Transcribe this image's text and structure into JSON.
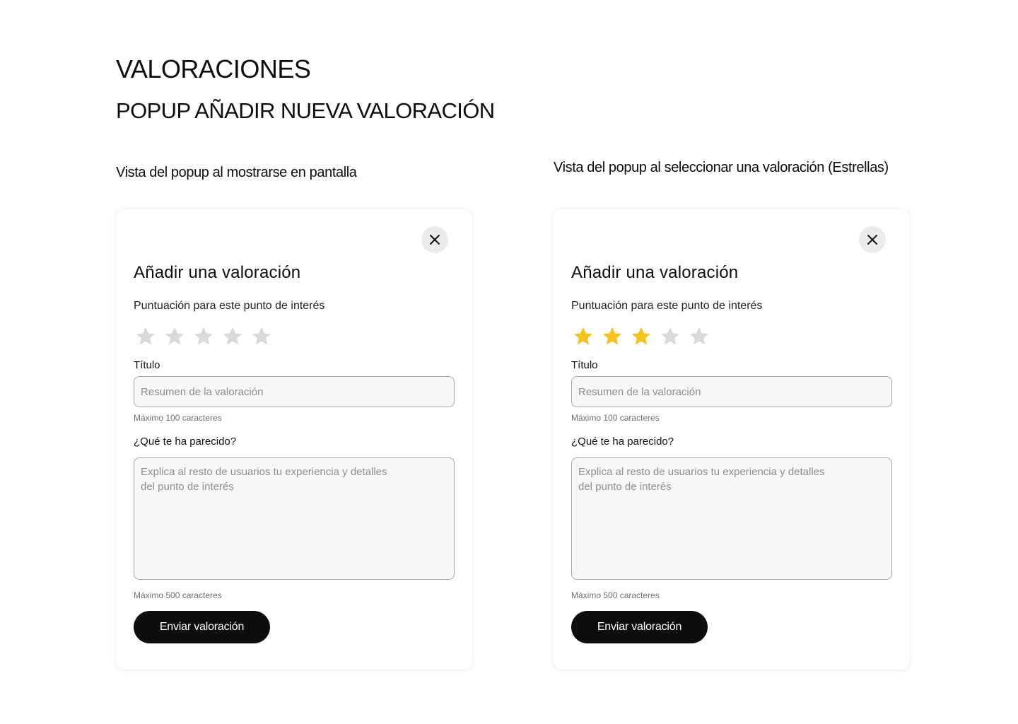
{
  "header": {
    "title": "VALORACIONES",
    "subtitle": "POPUP AÑADIR NUEVA VALORACIÓN"
  },
  "views": [
    {
      "caption": "Vista del popup al mostrarse en pantalla",
      "rating_value": 0,
      "rating_max": 5
    },
    {
      "caption": "Vista del popup al seleccionar una valoración (Estrellas)",
      "rating_value": 3,
      "rating_max": 5
    }
  ],
  "popup": {
    "close_icon": "close-icon",
    "heading": "Añadir una valoración",
    "score_label": "Puntuación para este punto de interés",
    "title_label": "Título",
    "title_placeholder": "Resumen de la valoración",
    "title_helper": "Máximo 100 caracteres",
    "opinion_label": "¿Qué te ha parecido?",
    "opinion_placeholder": "Explica al resto de usuarios tu experiencia y detalles\ndel punto de interés",
    "opinion_helper": "Máximo 500 caracteres",
    "submit_label": "Enviar valoración"
  },
  "colors": {
    "star_filled": "#f6c31c",
    "star_empty": "#d9d9d9",
    "button_bg": "#0d0d0d",
    "close_bg": "#ebebeb",
    "input_bg": "#f8f7f8"
  }
}
